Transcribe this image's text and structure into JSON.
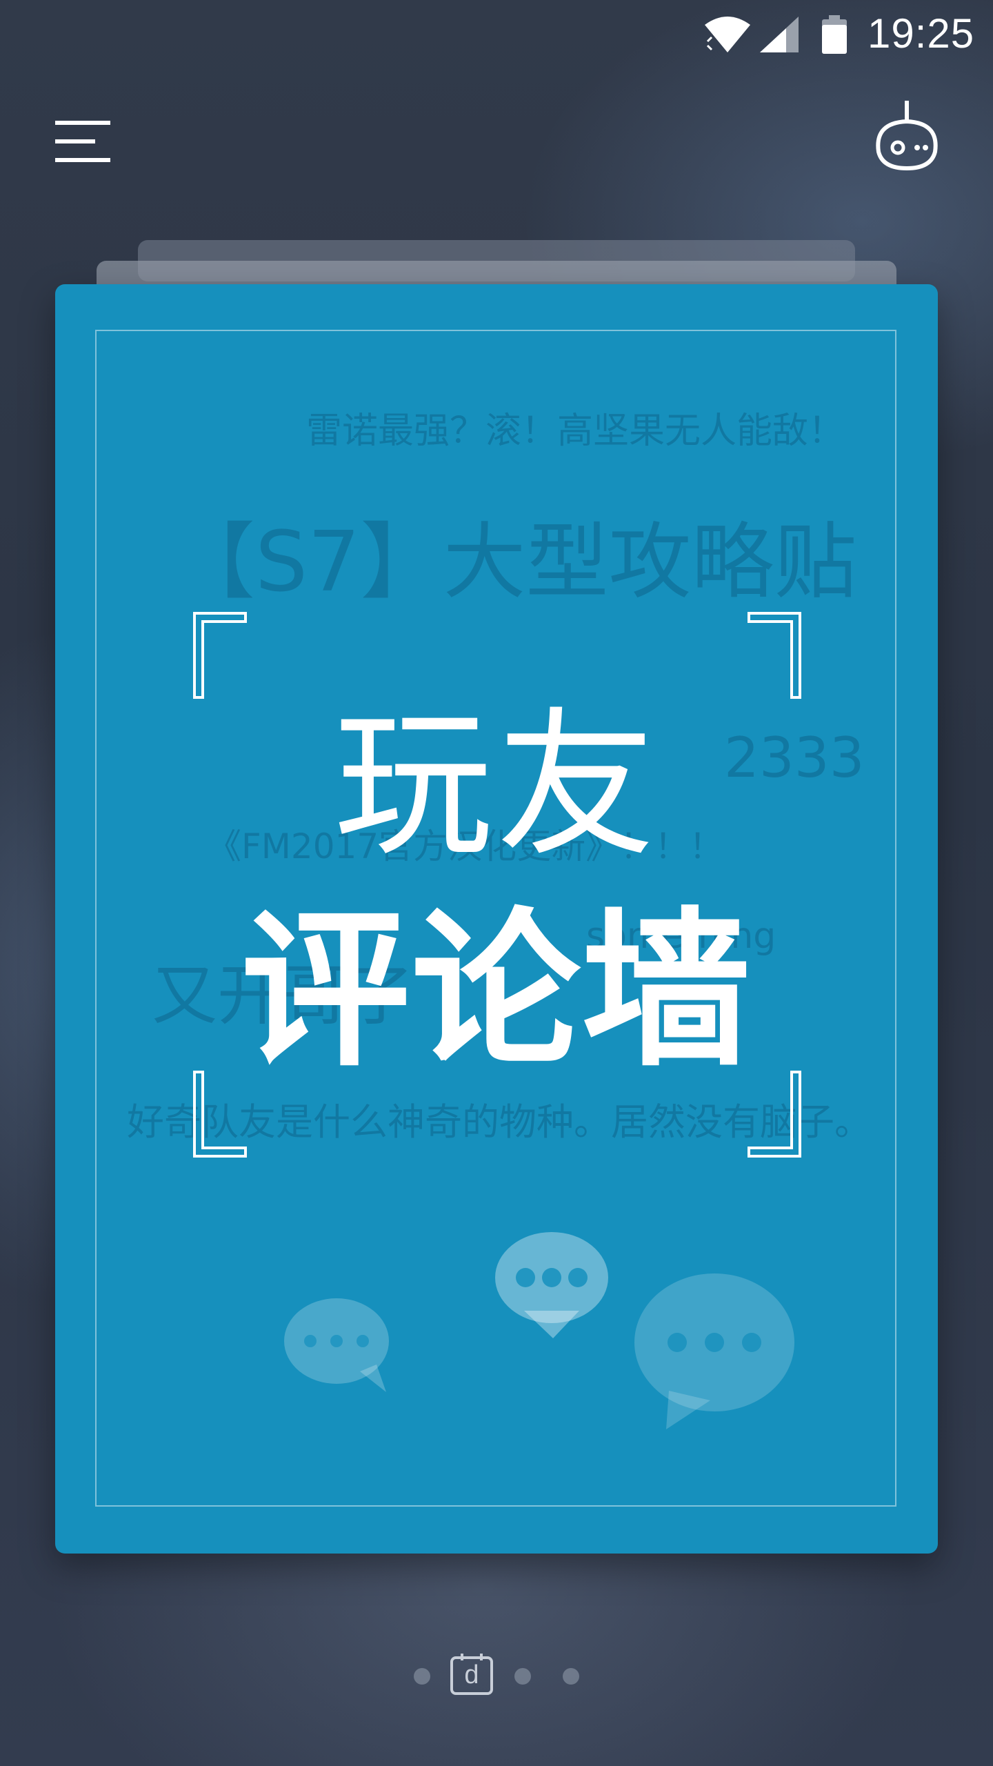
{
  "status_bar": {
    "time": "19:25",
    "icons": [
      "wifi-icon",
      "signal-icon",
      "battery-icon"
    ]
  },
  "app_bar": {
    "menu_icon": "menu-icon",
    "right_icon": "robot-icon"
  },
  "card": {
    "title_line1": "玩友",
    "title_line2": "评论墙",
    "background_comments": [
      "雷诺最强？滚！高坚果无人能敌！",
      "【S7】大型攻略贴",
      "2333",
      "《FM2017官方汉化更新》！！！",
      "something",
      "又开哥了",
      "好奇队友是什么神奇的物种。居然没有脑子。"
    ],
    "decoration_icons": [
      "chat-bubble-icon",
      "chat-bubble-icon",
      "chat-bubble-icon"
    ]
  },
  "pager": {
    "pages": 4,
    "active_index": 1,
    "active_letter": "d"
  },
  "colors": {
    "card_background": "#1690bd",
    "page_background": "#2f3a4c",
    "text": "#ffffff"
  }
}
